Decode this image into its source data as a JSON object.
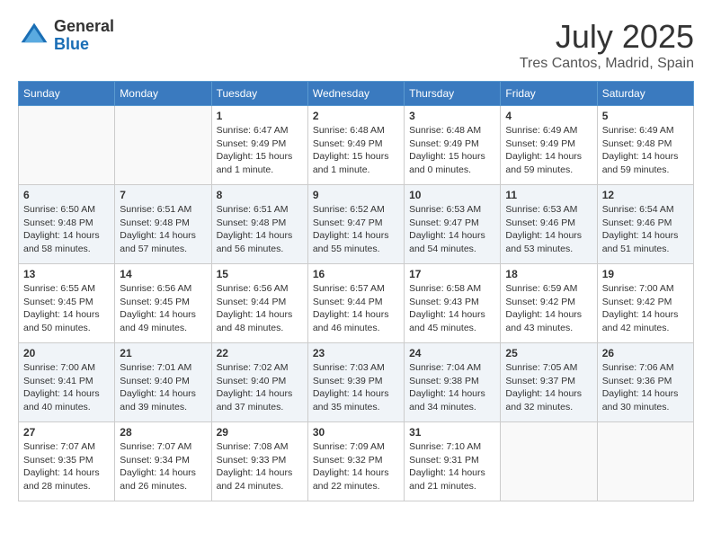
{
  "header": {
    "logo_line1": "General",
    "logo_line2": "Blue",
    "month": "July 2025",
    "location": "Tres Cantos, Madrid, Spain"
  },
  "weekdays": [
    "Sunday",
    "Monday",
    "Tuesday",
    "Wednesday",
    "Thursday",
    "Friday",
    "Saturday"
  ],
  "weeks": [
    [
      {
        "day": "",
        "info": ""
      },
      {
        "day": "",
        "info": ""
      },
      {
        "day": "1",
        "info": "Sunrise: 6:47 AM\nSunset: 9:49 PM\nDaylight: 15 hours and 1 minute."
      },
      {
        "day": "2",
        "info": "Sunrise: 6:48 AM\nSunset: 9:49 PM\nDaylight: 15 hours and 1 minute."
      },
      {
        "day": "3",
        "info": "Sunrise: 6:48 AM\nSunset: 9:49 PM\nDaylight: 15 hours and 0 minutes."
      },
      {
        "day": "4",
        "info": "Sunrise: 6:49 AM\nSunset: 9:49 PM\nDaylight: 14 hours and 59 minutes."
      },
      {
        "day": "5",
        "info": "Sunrise: 6:49 AM\nSunset: 9:48 PM\nDaylight: 14 hours and 59 minutes."
      }
    ],
    [
      {
        "day": "6",
        "info": "Sunrise: 6:50 AM\nSunset: 9:48 PM\nDaylight: 14 hours and 58 minutes."
      },
      {
        "day": "7",
        "info": "Sunrise: 6:51 AM\nSunset: 9:48 PM\nDaylight: 14 hours and 57 minutes."
      },
      {
        "day": "8",
        "info": "Sunrise: 6:51 AM\nSunset: 9:48 PM\nDaylight: 14 hours and 56 minutes."
      },
      {
        "day": "9",
        "info": "Sunrise: 6:52 AM\nSunset: 9:47 PM\nDaylight: 14 hours and 55 minutes."
      },
      {
        "day": "10",
        "info": "Sunrise: 6:53 AM\nSunset: 9:47 PM\nDaylight: 14 hours and 54 minutes."
      },
      {
        "day": "11",
        "info": "Sunrise: 6:53 AM\nSunset: 9:46 PM\nDaylight: 14 hours and 53 minutes."
      },
      {
        "day": "12",
        "info": "Sunrise: 6:54 AM\nSunset: 9:46 PM\nDaylight: 14 hours and 51 minutes."
      }
    ],
    [
      {
        "day": "13",
        "info": "Sunrise: 6:55 AM\nSunset: 9:45 PM\nDaylight: 14 hours and 50 minutes."
      },
      {
        "day": "14",
        "info": "Sunrise: 6:56 AM\nSunset: 9:45 PM\nDaylight: 14 hours and 49 minutes."
      },
      {
        "day": "15",
        "info": "Sunrise: 6:56 AM\nSunset: 9:44 PM\nDaylight: 14 hours and 48 minutes."
      },
      {
        "day": "16",
        "info": "Sunrise: 6:57 AM\nSunset: 9:44 PM\nDaylight: 14 hours and 46 minutes."
      },
      {
        "day": "17",
        "info": "Sunrise: 6:58 AM\nSunset: 9:43 PM\nDaylight: 14 hours and 45 minutes."
      },
      {
        "day": "18",
        "info": "Sunrise: 6:59 AM\nSunset: 9:42 PM\nDaylight: 14 hours and 43 minutes."
      },
      {
        "day": "19",
        "info": "Sunrise: 7:00 AM\nSunset: 9:42 PM\nDaylight: 14 hours and 42 minutes."
      }
    ],
    [
      {
        "day": "20",
        "info": "Sunrise: 7:00 AM\nSunset: 9:41 PM\nDaylight: 14 hours and 40 minutes."
      },
      {
        "day": "21",
        "info": "Sunrise: 7:01 AM\nSunset: 9:40 PM\nDaylight: 14 hours and 39 minutes."
      },
      {
        "day": "22",
        "info": "Sunrise: 7:02 AM\nSunset: 9:40 PM\nDaylight: 14 hours and 37 minutes."
      },
      {
        "day": "23",
        "info": "Sunrise: 7:03 AM\nSunset: 9:39 PM\nDaylight: 14 hours and 35 minutes."
      },
      {
        "day": "24",
        "info": "Sunrise: 7:04 AM\nSunset: 9:38 PM\nDaylight: 14 hours and 34 minutes."
      },
      {
        "day": "25",
        "info": "Sunrise: 7:05 AM\nSunset: 9:37 PM\nDaylight: 14 hours and 32 minutes."
      },
      {
        "day": "26",
        "info": "Sunrise: 7:06 AM\nSunset: 9:36 PM\nDaylight: 14 hours and 30 minutes."
      }
    ],
    [
      {
        "day": "27",
        "info": "Sunrise: 7:07 AM\nSunset: 9:35 PM\nDaylight: 14 hours and 28 minutes."
      },
      {
        "day": "28",
        "info": "Sunrise: 7:07 AM\nSunset: 9:34 PM\nDaylight: 14 hours and 26 minutes."
      },
      {
        "day": "29",
        "info": "Sunrise: 7:08 AM\nSunset: 9:33 PM\nDaylight: 14 hours and 24 minutes."
      },
      {
        "day": "30",
        "info": "Sunrise: 7:09 AM\nSunset: 9:32 PM\nDaylight: 14 hours and 22 minutes."
      },
      {
        "day": "31",
        "info": "Sunrise: 7:10 AM\nSunset: 9:31 PM\nDaylight: 14 hours and 21 minutes."
      },
      {
        "day": "",
        "info": ""
      },
      {
        "day": "",
        "info": ""
      }
    ]
  ]
}
